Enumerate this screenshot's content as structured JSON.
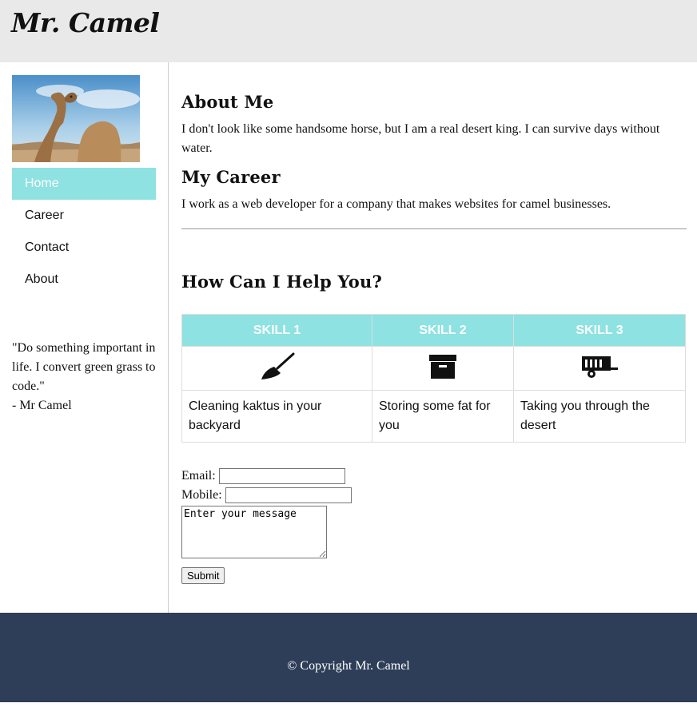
{
  "header": {
    "logo_text": "Mr. Camel"
  },
  "sidebar": {
    "nav": [
      {
        "label": "Home",
        "active": true
      },
      {
        "label": "Career",
        "active": false
      },
      {
        "label": "Contact",
        "active": false
      },
      {
        "label": "About",
        "active": false
      }
    ],
    "quote_lines": [
      "\"Do something important in life. I convert green grass to code.\"",
      "- Mr Camel"
    ]
  },
  "main": {
    "about": {
      "heading": "About Me",
      "text": "I don't look like some handsome horse, but I am a real desert king. I can survive days without water."
    },
    "career": {
      "heading": "My Career",
      "text": "I work as a web developer for a company that makes websites for camel businesses."
    },
    "help": {
      "heading": "How Can I Help You?",
      "skills": [
        {
          "header": "SKILL 1",
          "icon": "broom-icon",
          "text": "Cleaning kaktus in your backyard"
        },
        {
          "header": "SKILL 2",
          "icon": "archive-box-icon",
          "text": "Storing some fat for you"
        },
        {
          "header": "SKILL 3",
          "icon": "trailer-icon",
          "text": "Taking you through the desert"
        }
      ]
    },
    "form": {
      "email_label": "Email:",
      "mobile_label": "Mobile:",
      "message_placeholder": "Enter your message",
      "submit_label": "Submit"
    }
  },
  "footer": {
    "text": "© Copyright Mr. Camel"
  },
  "colors": {
    "accent": "#8ee2e2",
    "footer": "#2e3e58",
    "header": "#e9e9e9"
  }
}
